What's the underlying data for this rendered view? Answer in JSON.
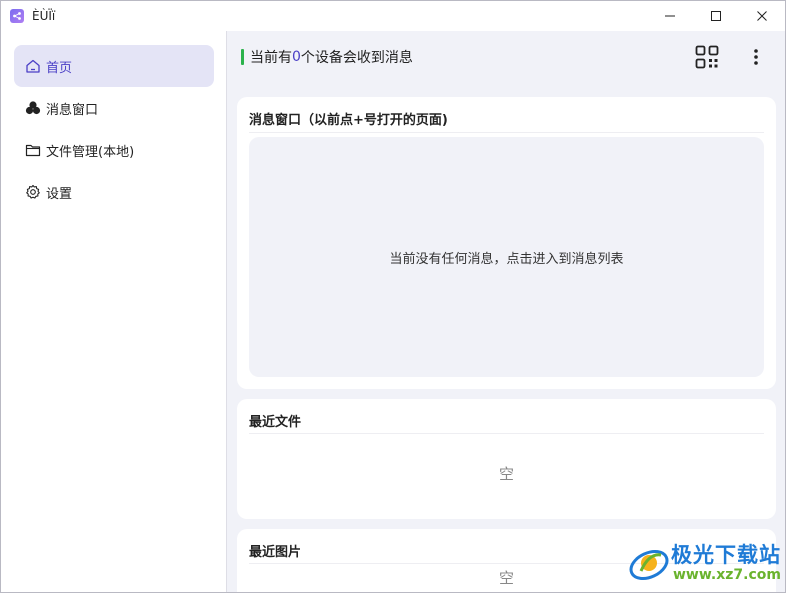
{
  "window": {
    "title": "ÈÙÏï",
    "controls": [
      "minimize-icon",
      "maximize-icon",
      "close-icon"
    ]
  },
  "sidebar": {
    "items": [
      {
        "label": "首页",
        "icon": "home-icon",
        "active": true
      },
      {
        "label": "消息窗口",
        "icon": "clover-icon",
        "active": false
      },
      {
        "label": "文件管理(本地)",
        "icon": "folder-icon",
        "active": false
      },
      {
        "label": "设置",
        "icon": "gear-icon",
        "active": false
      }
    ]
  },
  "header": {
    "status_prefix": "当前有",
    "status_count": "0",
    "status_suffix": "个设备会收到消息",
    "qr_icon": "qr-code-icon",
    "more_icon": "more-vertical-icon"
  },
  "cards": {
    "messages": {
      "title": "消息窗口（以前点+号打开的页面)",
      "empty_text": "当前没有任何消息，点击进入到消息列表"
    },
    "recent_files": {
      "title": "最近文件",
      "empty_text": "空"
    },
    "recent_images": {
      "title": "最近图片",
      "empty_text": "空"
    }
  },
  "watermark": {
    "brand": "极光下载站",
    "url": "www.xz7.com"
  },
  "colors": {
    "accent": "#4a3fc6",
    "active_bg": "#e4e4f6",
    "status_bar": "#2bb24c",
    "main_bg": "#f1f2f8"
  }
}
